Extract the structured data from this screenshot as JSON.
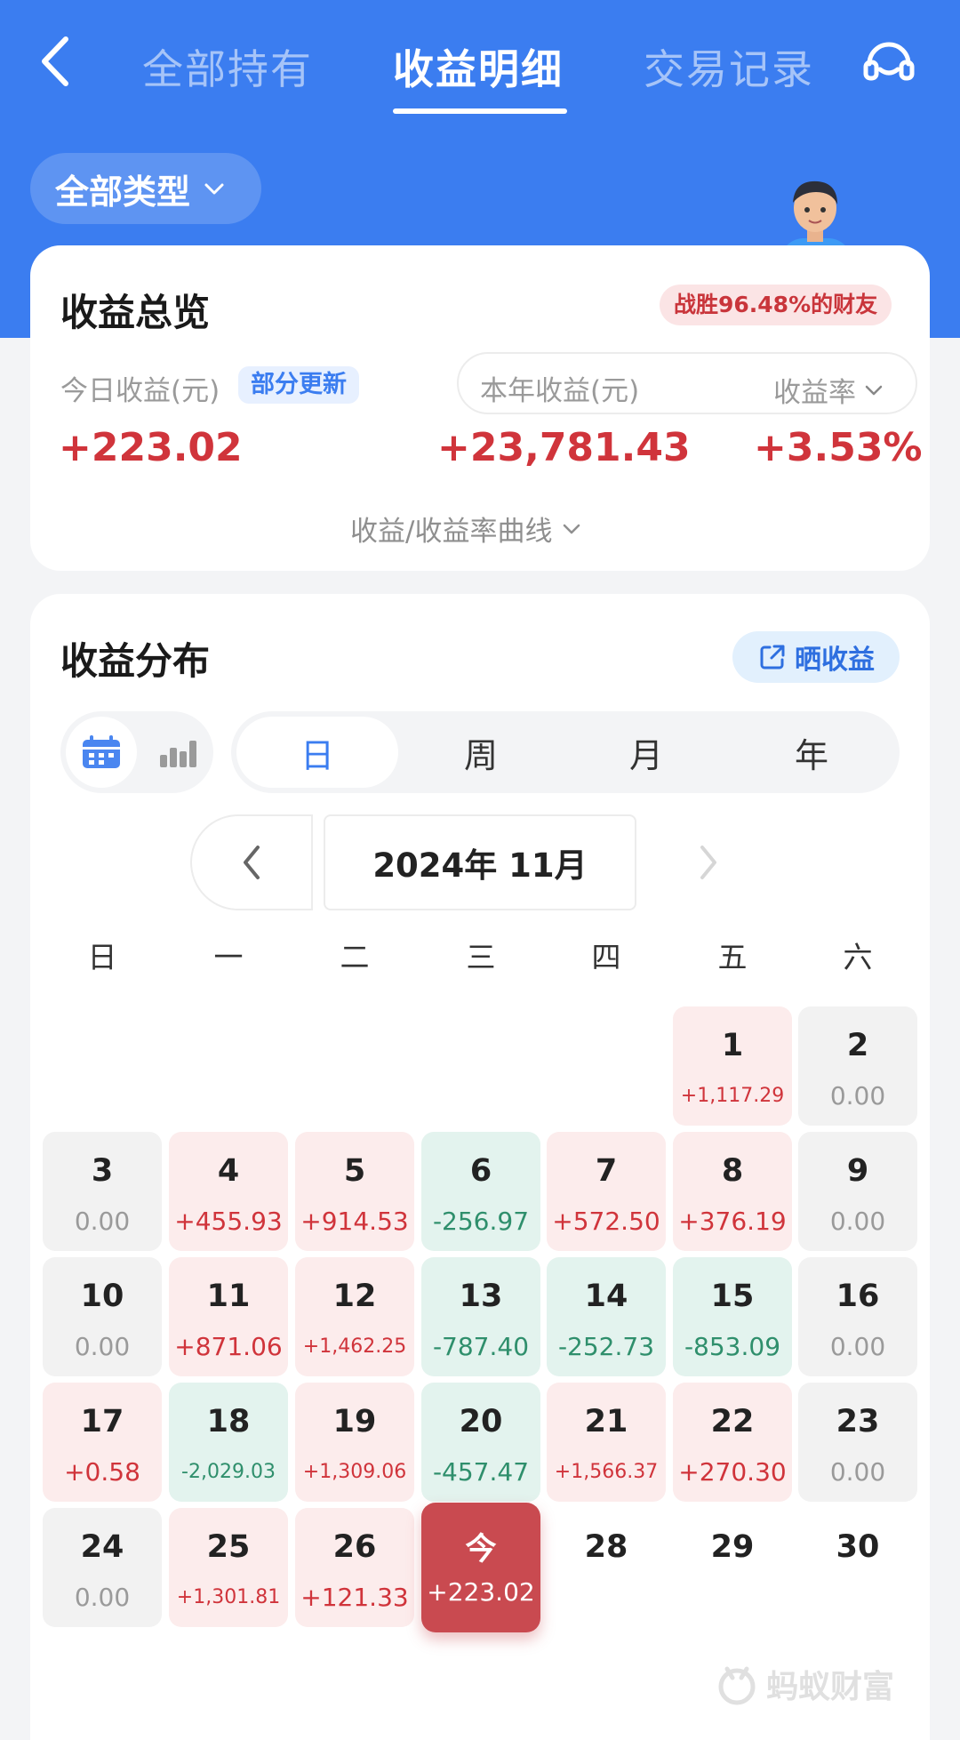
{
  "colors": {
    "brand_blue": "#3b7df0",
    "positive": "#d0343b",
    "negative": "#2f8f6c",
    "neutral": "#9a9a9a"
  },
  "nav": {
    "tabs": [
      "全部持有",
      "收益明细",
      "交易记录"
    ],
    "active_tab": "收益明细",
    "back_icon": "chevron-left-icon",
    "service_icon": "headset-icon"
  },
  "filter": {
    "type_label": "全部类型"
  },
  "overview": {
    "title": "收益总览",
    "beat_badge": "战胜96.48%的财友",
    "today_label": "今日收益(元)",
    "partial_update": "部分更新",
    "year_label": "本年收益(元)",
    "rate_label": "收益率",
    "today_value": "+223.02",
    "year_value": "+23,781.43",
    "rate_value": "+3.53%",
    "curve_toggle": "收益/收益率曲线"
  },
  "distribution": {
    "title": "收益分布",
    "share_label": "晒收益",
    "periods": [
      "日",
      "周",
      "月",
      "年"
    ],
    "active_period": "日",
    "month_label": "2024年 11月",
    "weekdays": [
      "日",
      "一",
      "二",
      "三",
      "四",
      "五",
      "六"
    ],
    "days": [
      {
        "num": "1",
        "val": "+1,117.29",
        "kind": "pos"
      },
      {
        "num": "2",
        "val": "0.00",
        "kind": "zero"
      },
      {
        "num": "3",
        "val": "0.00",
        "kind": "zero"
      },
      {
        "num": "4",
        "val": "+455.93",
        "kind": "pos"
      },
      {
        "num": "5",
        "val": "+914.53",
        "kind": "pos"
      },
      {
        "num": "6",
        "val": "-256.97",
        "kind": "neg"
      },
      {
        "num": "7",
        "val": "+572.50",
        "kind": "pos"
      },
      {
        "num": "8",
        "val": "+376.19",
        "kind": "pos"
      },
      {
        "num": "9",
        "val": "0.00",
        "kind": "zero"
      },
      {
        "num": "10",
        "val": "0.00",
        "kind": "zero"
      },
      {
        "num": "11",
        "val": "+871.06",
        "kind": "pos"
      },
      {
        "num": "12",
        "val": "+1,462.25",
        "kind": "pos"
      },
      {
        "num": "13",
        "val": "-787.40",
        "kind": "neg"
      },
      {
        "num": "14",
        "val": "-252.73",
        "kind": "neg"
      },
      {
        "num": "15",
        "val": "-853.09",
        "kind": "neg"
      },
      {
        "num": "16",
        "val": "0.00",
        "kind": "zero"
      },
      {
        "num": "17",
        "val": "+0.58",
        "kind": "pos"
      },
      {
        "num": "18",
        "val": "-2,029.03",
        "kind": "neg"
      },
      {
        "num": "19",
        "val": "+1,309.06",
        "kind": "pos"
      },
      {
        "num": "20",
        "val": "-457.47",
        "kind": "neg"
      },
      {
        "num": "21",
        "val": "+1,566.37",
        "kind": "pos"
      },
      {
        "num": "22",
        "val": "+270.30",
        "kind": "pos"
      },
      {
        "num": "23",
        "val": "0.00",
        "kind": "zero"
      },
      {
        "num": "24",
        "val": "0.00",
        "kind": "zero"
      },
      {
        "num": "25",
        "val": "+1,301.81",
        "kind": "pos"
      },
      {
        "num": "26",
        "val": "+121.33",
        "kind": "pos"
      },
      {
        "num": "今",
        "val": "+223.02",
        "kind": "today"
      },
      {
        "num": "28",
        "val": "",
        "kind": "future"
      },
      {
        "num": "29",
        "val": "",
        "kind": "future"
      },
      {
        "num": "30",
        "val": "",
        "kind": "future"
      }
    ]
  },
  "brand": {
    "name": "蚂蚁财富",
    "icon": "ant-logo-icon"
  }
}
